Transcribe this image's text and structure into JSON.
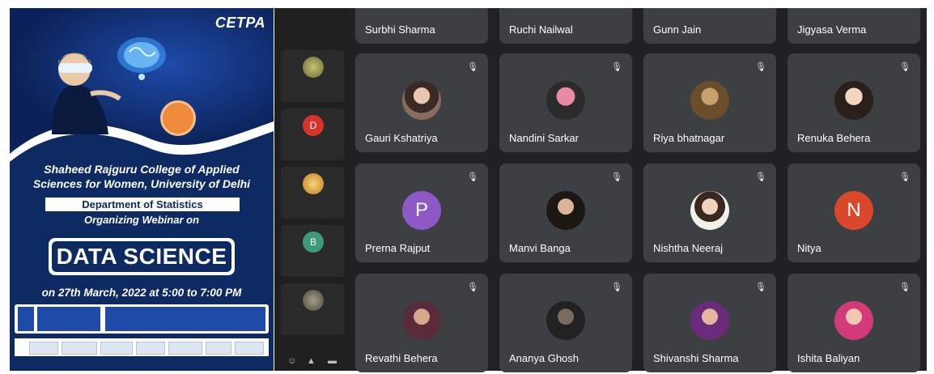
{
  "poster": {
    "brand": "CETPA",
    "college_line1": "Shaheed Rajguru College of Applied",
    "college_line2": "Sciences for Women, University of Delhi",
    "department": "Department of Statistics",
    "organizing": "Organizing Webinar on",
    "topic": "DATA SCIENCE",
    "date_line": "on 27th March, 2022 at 5:00 to 7:00 PM"
  },
  "strip": {
    "participants": [
      {
        "label": "",
        "avatar_color": "#8d8a3a"
      },
      {
        "label": "",
        "avatar_color": "#d9342b",
        "letter": "D"
      },
      {
        "label": "",
        "avatar_color": "#e6a52f"
      },
      {
        "label": "",
        "avatar_color": "#3d9b7a",
        "letter": "B"
      },
      {
        "label": "",
        "avatar_color": "#6b6b5a"
      }
    ]
  },
  "grid": {
    "top_row": [
      "Surbhi Sharma",
      "Ruchi Nailwal",
      "Gunn Jain",
      "Jigyasa Verma"
    ],
    "rows": [
      [
        {
          "name": "Gauri Kshatriya",
          "type": "photo"
        },
        {
          "name": "Nandini Sarkar",
          "type": "photo"
        },
        {
          "name": "Riya bhatnagar",
          "type": "photo"
        },
        {
          "name": "Renuka Behera",
          "type": "photo"
        }
      ],
      [
        {
          "name": "Prerna Rajput",
          "type": "letter",
          "letter": "P",
          "color": "#8e58c7"
        },
        {
          "name": "Manvi Banga",
          "type": "photo"
        },
        {
          "name": "Nishtha Neeraj",
          "type": "photo"
        },
        {
          "name": "Nitya",
          "type": "letter",
          "letter": "N",
          "color": "#d9482b"
        }
      ],
      [
        {
          "name": "Revathi Behera",
          "type": "photo"
        },
        {
          "name": "Ananya Ghosh",
          "type": "photo"
        },
        {
          "name": "Shivanshi Sharma",
          "type": "photo"
        },
        {
          "name": "Ishita Baliyan",
          "type": "photo"
        }
      ]
    ]
  },
  "icons": {
    "mute": "mic-off-icon"
  }
}
